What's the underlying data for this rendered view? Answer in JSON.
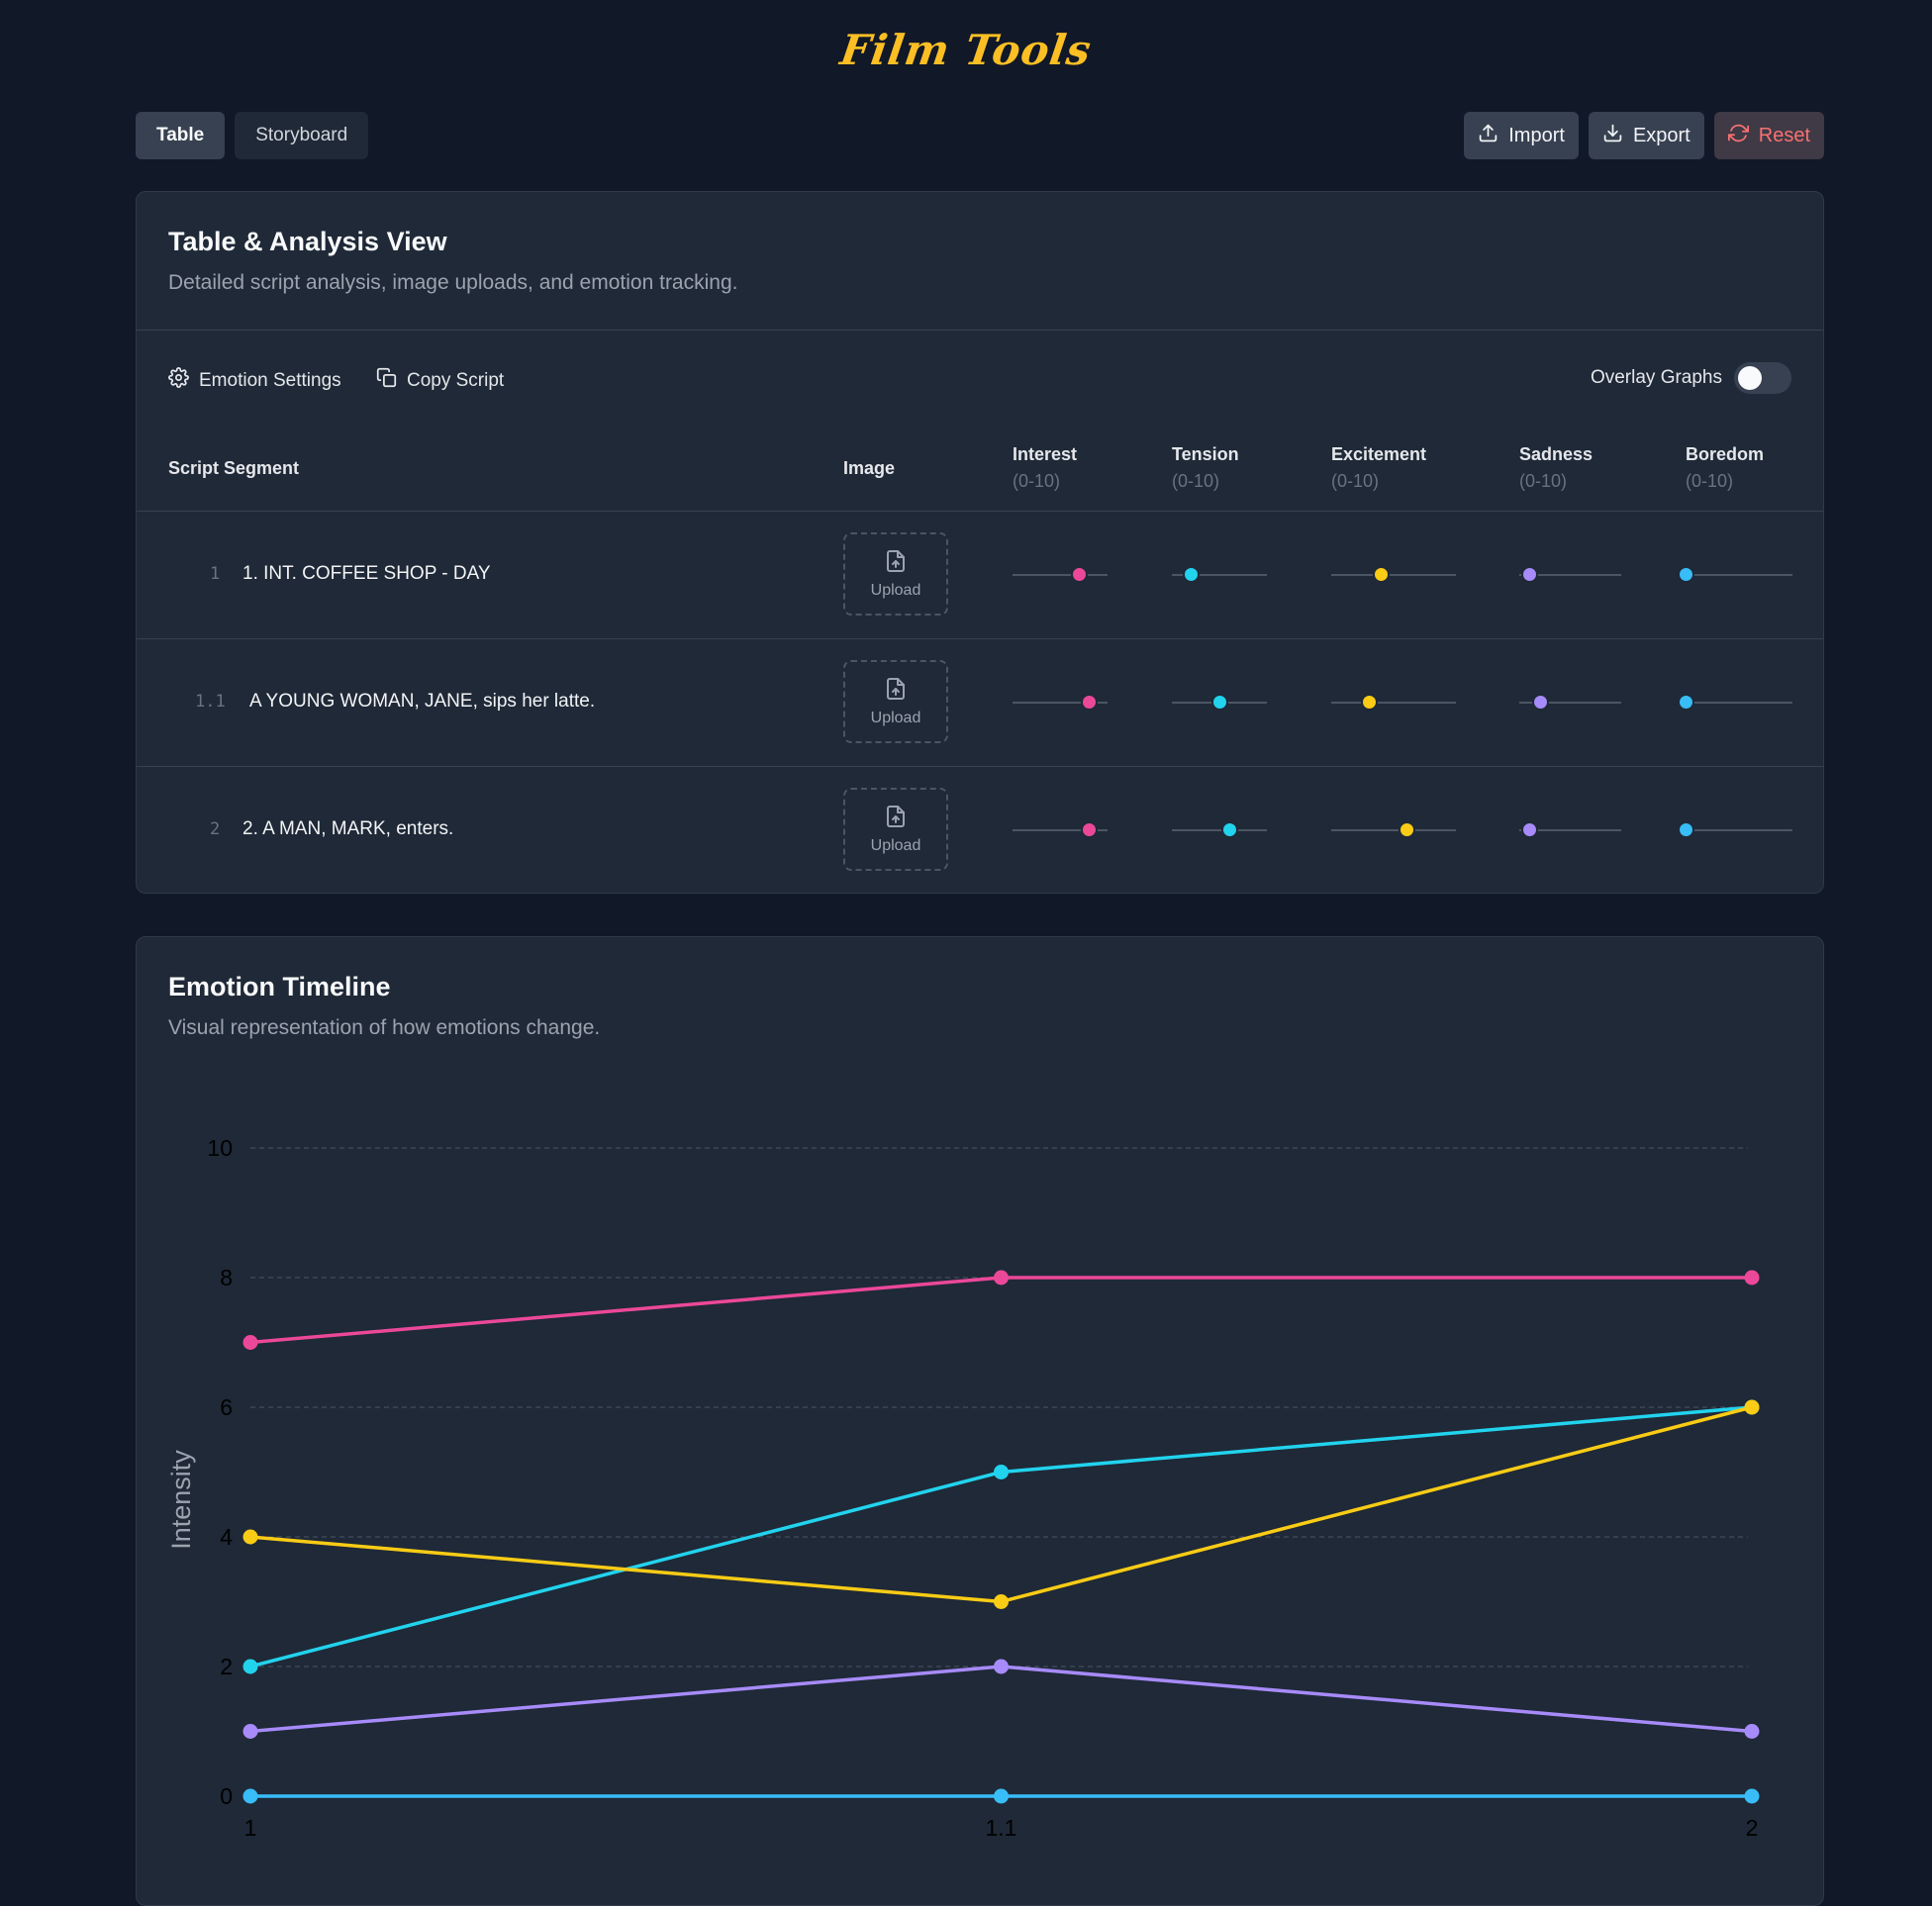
{
  "app": {
    "logo": "Film Tools"
  },
  "tabs": [
    {
      "label": "Table",
      "active": true
    },
    {
      "label": "Storyboard",
      "active": false
    }
  ],
  "actions": {
    "import": "Import",
    "export": "Export",
    "reset": "Reset"
  },
  "table_card": {
    "title": "Table & Analysis View",
    "subtitle": "Detailed script analysis, image uploads, and emotion tracking.",
    "toolbar": {
      "emotion_settings": "Emotion Settings",
      "copy_script": "Copy Script",
      "overlay_label": "Overlay Graphs",
      "overlay_on": false
    },
    "headers": {
      "segment": "Script Segment",
      "image": "Image",
      "emotions": [
        {
          "name": "Interest",
          "range": "(0-10)",
          "color": "#ec4899"
        },
        {
          "name": "Tension",
          "range": "(0-10)",
          "color": "#22d3ee"
        },
        {
          "name": "Excitement",
          "range": "(0-10)",
          "color": "#facc15"
        },
        {
          "name": "Sadness",
          "range": "(0-10)",
          "color": "#a78bfa"
        },
        {
          "name": "Boredom",
          "range": "(0-10)",
          "color": "#38bdf8"
        }
      ]
    },
    "upload_label": "Upload",
    "rows": [
      {
        "num": "1",
        "text": "1. INT. COFFEE SHOP - DAY",
        "values": [
          7,
          2,
          4,
          1,
          0
        ]
      },
      {
        "num": "1.1",
        "text": "A YOUNG WOMAN, JANE, sips her latte.",
        "values": [
          8,
          5,
          3,
          2,
          0
        ]
      },
      {
        "num": "2",
        "text": "2. A MAN, MARK, enters.",
        "values": [
          8,
          6,
          6,
          1,
          0
        ]
      }
    ]
  },
  "chart_card": {
    "title": "Emotion Timeline",
    "subtitle": "Visual representation of how emotions change."
  },
  "chart_data": {
    "type": "line",
    "x": [
      "1",
      "1.1",
      "2"
    ],
    "ylabel": "Intensity",
    "ylim": [
      0,
      10
    ],
    "yticks": [
      0,
      2,
      4,
      6,
      8,
      10
    ],
    "grid": true,
    "series": [
      {
        "color": "#ec4899",
        "values": [
          7,
          8,
          8
        ]
      },
      {
        "color": "#22d3ee",
        "values": [
          2,
          5,
          6
        ]
      },
      {
        "color": "#facc15",
        "values": [
          4,
          3,
          6
        ]
      },
      {
        "color": "#a78bfa",
        "values": [
          1,
          2,
          1
        ]
      },
      {
        "color": "#38bdf8",
        "values": [
          0,
          0,
          0
        ]
      }
    ]
  }
}
